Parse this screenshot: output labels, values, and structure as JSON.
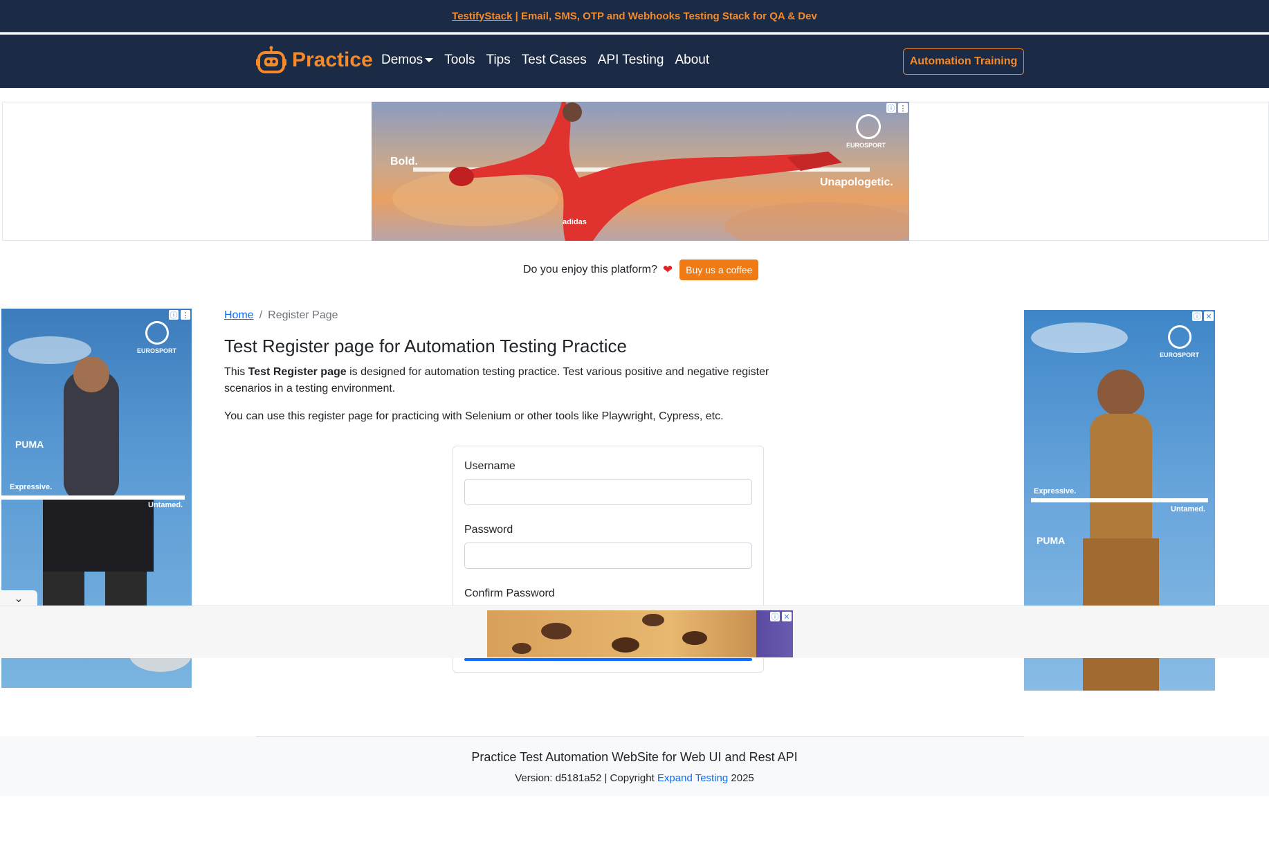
{
  "top_banner": {
    "link": "TestifyStack",
    "text": " | Email, SMS, OTP and Webhooks Testing Stack for QA & Dev"
  },
  "navbar": {
    "brand": "Practice",
    "links": [
      "Demos",
      "Tools",
      "Tips",
      "Test Cases",
      "API Testing",
      "About"
    ],
    "training_button": "Automation Training"
  },
  "ads": {
    "top": {
      "brand": "EUROSPORT",
      "left_text": "Bold.",
      "right_text": "Unapologetic.",
      "logo": "adidas"
    },
    "left": {
      "brand": "EUROSPORT",
      "logo": "PUMA",
      "text1": "Expressive.",
      "text2": "Untamed."
    },
    "right": {
      "brand": "EUROSPORT",
      "logo": "PUMA",
      "text1": "Expressive.",
      "text2": "Untamed."
    }
  },
  "coffee": {
    "question": "Do you enjoy this platform?",
    "button": "Buy us a coffee"
  },
  "breadcrumb": {
    "home": "Home",
    "current": "Register Page"
  },
  "page": {
    "title": "Test Register page for Automation Testing Practice",
    "desc_prefix": "This ",
    "desc_bold": "Test Register page",
    "desc_suffix": " is designed for automation testing practice. Test various positive and negative register scenarios in a testing environment.",
    "desc2": "You can use this register page for practicing with Selenium or other tools like Playwright, Cypress, etc."
  },
  "form": {
    "username_label": "Username",
    "password_label": "Password",
    "confirm_label": "Confirm Password"
  },
  "footer": {
    "title": "Practice Test Automation WebSite for Web UI and Rest API",
    "version_prefix": "Version: d5181a52 | Copyright ",
    "company": "Expand Testing",
    "year": " 2025"
  },
  "colors": {
    "navy": "#1b2a45",
    "orange": "#f58a2a",
    "link": "#0d6efd"
  }
}
